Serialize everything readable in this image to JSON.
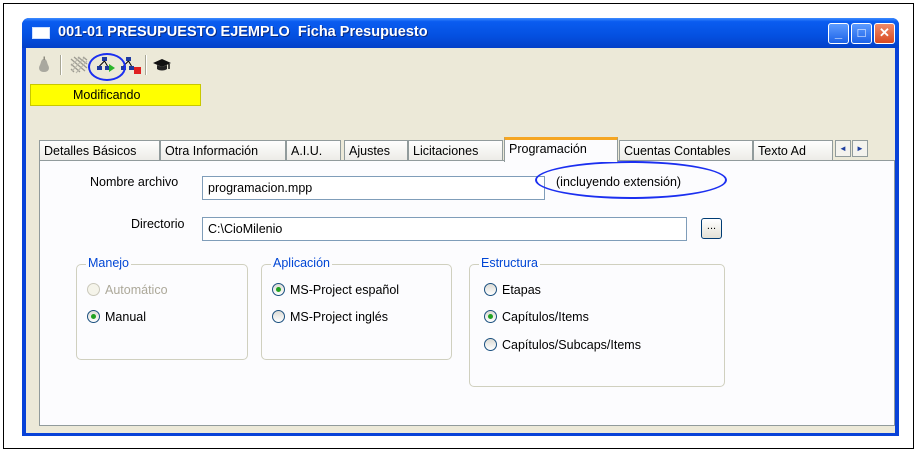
{
  "window": {
    "title": "001-01 PRESUPUESTO EJEMPLO  Ficha Presupuesto",
    "minimize_symbol": "_",
    "maximize_symbol": "□",
    "close_symbol": "✕"
  },
  "toolbar": {
    "icons": [
      "pear-icon",
      "grid-icon",
      "network-export-icon",
      "network-delete-icon",
      "mortarboard-icon"
    ],
    "highlighted_icon": "network-export-icon"
  },
  "status": {
    "text": "Modificando",
    "color": "#ffff00"
  },
  "tabs": [
    {
      "label": "Detalles Básicos",
      "active": false
    },
    {
      "label": "Otra Información",
      "active": false
    },
    {
      "label": "A.I.U.",
      "active": false
    },
    {
      "label": "Ajustes",
      "active": false
    },
    {
      "label": "Licitaciones",
      "active": false
    },
    {
      "label": "Programación",
      "active": true
    },
    {
      "label": "Cuentas Contables",
      "active": false
    },
    {
      "label": "Texto Ad",
      "active": false
    }
  ],
  "tab_scroll": {
    "left": "◄",
    "right": "►"
  },
  "form": {
    "filename_label": "Nombre archivo",
    "filename_value": "programacion.mpp",
    "filename_hint": "(incluyendo extensión)",
    "directory_label": "Directorio",
    "directory_value": "C:\\CioMilenio",
    "browse_label": "..."
  },
  "groups": {
    "manejo": {
      "title": "Manejo",
      "options": [
        {
          "label": "Automático",
          "checked": false,
          "disabled": true
        },
        {
          "label": "Manual",
          "checked": true,
          "disabled": false
        }
      ]
    },
    "aplicacion": {
      "title": "Aplicación",
      "options": [
        {
          "label": "MS-Project español",
          "checked": true,
          "disabled": false
        },
        {
          "label": "MS-Project inglés",
          "checked": false,
          "disabled": false
        }
      ]
    },
    "estructura": {
      "title": "Estructura",
      "options": [
        {
          "label": "Etapas",
          "checked": false,
          "disabled": false
        },
        {
          "label": "Capítulos/Items",
          "checked": true,
          "disabled": false
        },
        {
          "label": "Capítulos/Subcaps/Items",
          "checked": false,
          "disabled": false
        }
      ]
    }
  },
  "colors": {
    "titlebar": "#0450e0",
    "annotation_circle": "#1b2ff0",
    "active_tab_accent": "#f5a623",
    "group_title": "#0046d5",
    "radio_dot": "#21a121"
  }
}
